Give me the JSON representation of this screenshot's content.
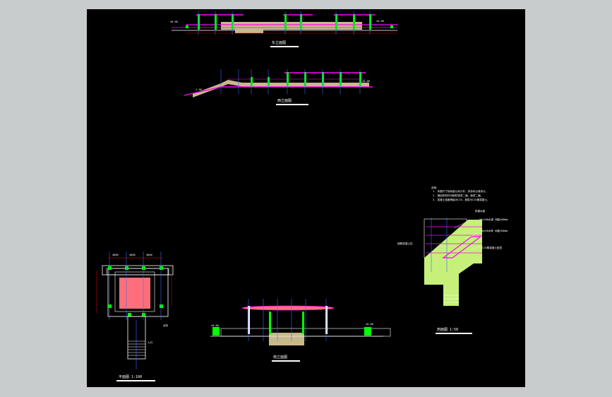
{
  "colors": {
    "background": "#c9cccd",
    "canvas": "#000000",
    "column": "#00ff00",
    "beam": "#ff00ff",
    "floor_fill": "#c8b98a",
    "dimension": "#ff0000",
    "axis": "#3a6cff",
    "roof_fill": "#ff6f7a",
    "slope_fill": "#c6f07a",
    "line": "#ffffff"
  },
  "views": {
    "elevation_1": {
      "caption": "东立面图",
      "level_left": "±0.00",
      "level_right": "±0.00"
    },
    "elevation_2": {
      "caption": "西立面图",
      "level_left": "-1.50",
      "level_right": "±0.00"
    },
    "plan": {
      "caption": "平面图 1:100",
      "dim_top": [
        "4000",
        "4000",
        "4000"
      ],
      "label_entry": "入口",
      "label_step": "台阶"
    },
    "elevation_3": {
      "caption": "南立面图",
      "level_left": "±0.00",
      "level_right": "±0.00"
    },
    "section": {
      "caption": "剖面图 1:50",
      "title": "说明",
      "notes": [
        "1. 本图尺寸除标高以米计外，其余均以毫米计。",
        "2. 钢结构构件均刷防锈漆二遍，面漆二遍。",
        "3. 混凝土强度等级为C25，垫层为C15素混凝土。"
      ],
      "labels": [
        "防腐木板",
        "50x100木梁 间距400mm",
        "50x50木条 间距300mm",
        "钢筋混凝土柱",
        "C15素混凝土垫层"
      ]
    }
  }
}
